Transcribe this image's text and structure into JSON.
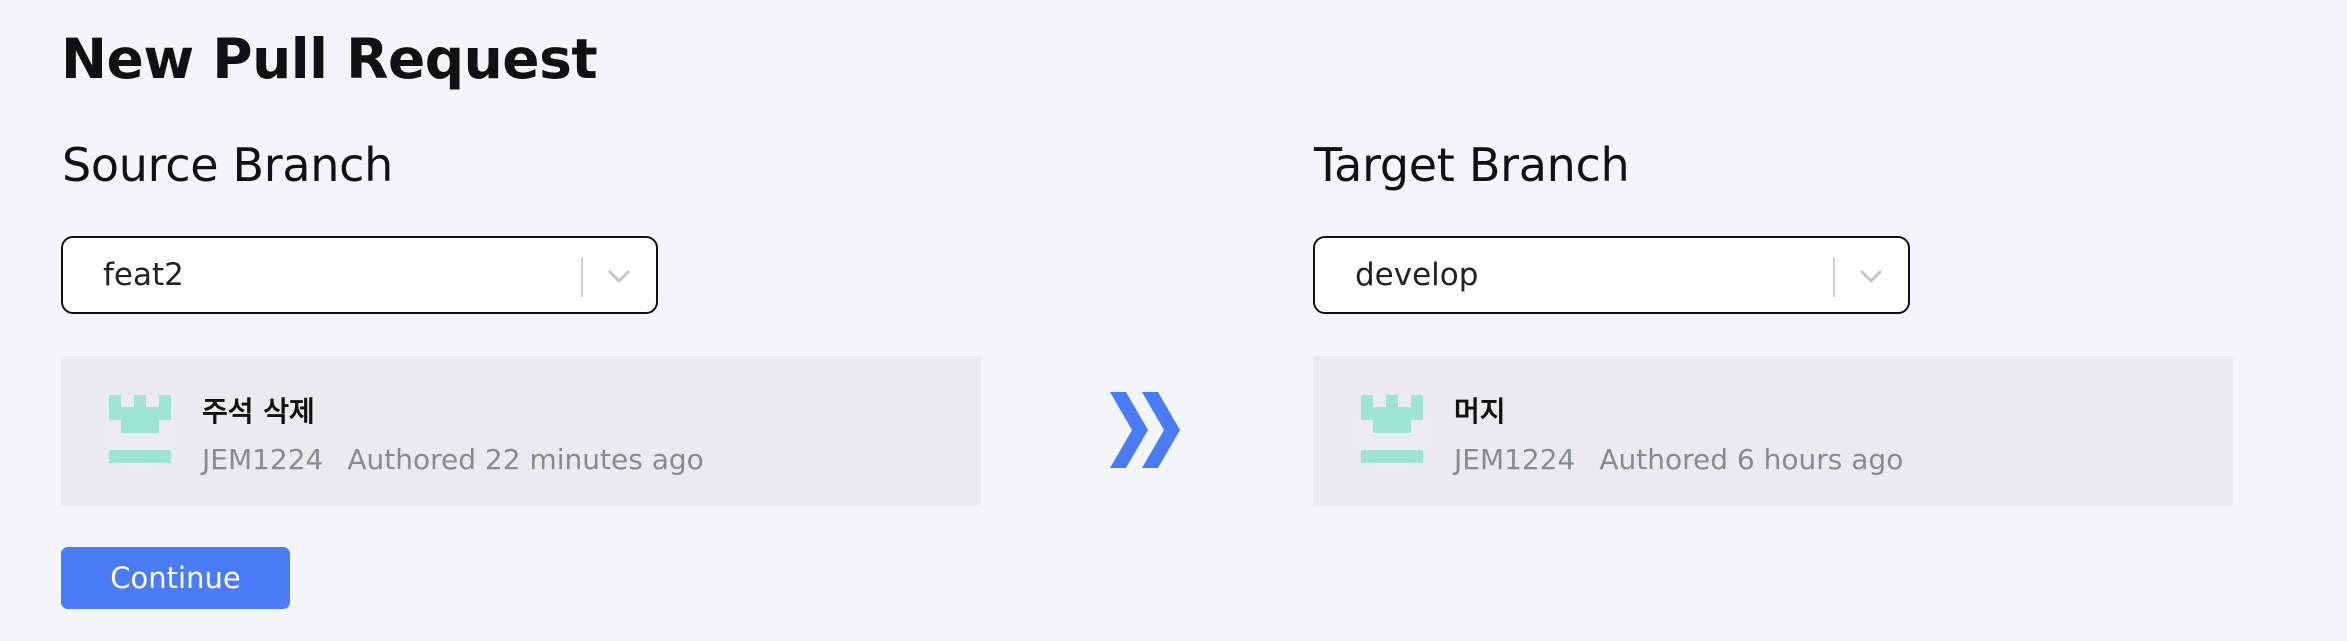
{
  "page": {
    "title": "New Pull Request"
  },
  "source": {
    "heading": "Source Branch",
    "branch": "feat2",
    "commit": {
      "message": "주석 삭제",
      "author": "JEM1224",
      "authored": "Authored 22 minutes ago"
    }
  },
  "target": {
    "heading": "Target Branch",
    "branch": "develop",
    "commit": {
      "message": "머지",
      "author": "JEM1224",
      "authored": "Authored 6 hours ago"
    }
  },
  "actions": {
    "continue_label": "Continue"
  },
  "icons": {
    "direction": "double-chevron-right-icon",
    "dropdown": "chevron-down-icon",
    "avatar": "identicon-avatar"
  },
  "colors": {
    "background": "#f4f5f8",
    "primary": "#4a7cf7",
    "card": "#ebebed",
    "avatar_mint": "#9ee6cf",
    "muted_text": "#868a93"
  }
}
